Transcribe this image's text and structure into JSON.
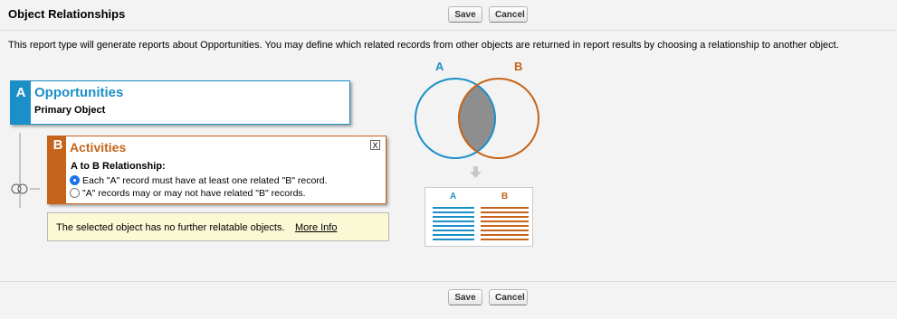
{
  "header": {
    "title": "Object Relationships",
    "save_label": "Save",
    "cancel_label": "Cancel"
  },
  "description": "This report type will generate reports about Opportunities. You may define which related records from other objects are returned in report results by choosing a relationship to another object.",
  "object_a": {
    "letter": "A",
    "name": "Opportunities",
    "subtitle": "Primary Object",
    "color": "#1b8fc8"
  },
  "object_b": {
    "letter": "B",
    "name": "Activities",
    "color": "#c5641a",
    "close_label": "X",
    "relationship_label": "A to B Relationship:",
    "options": [
      {
        "label": "Each \"A\" record must have at least one related \"B\" record.",
        "checked": true
      },
      {
        "label": "\"A\" records may or may not have related \"B\" records.",
        "checked": false
      }
    ]
  },
  "info": {
    "text": "The selected object has no further relatable objects.",
    "link": "More Info"
  },
  "venn": {
    "label_a": "A",
    "label_b": "B"
  },
  "result_table": {
    "col_a": "A",
    "col_b": "B"
  },
  "footer": {
    "save_label": "Save",
    "cancel_label": "Cancel"
  }
}
